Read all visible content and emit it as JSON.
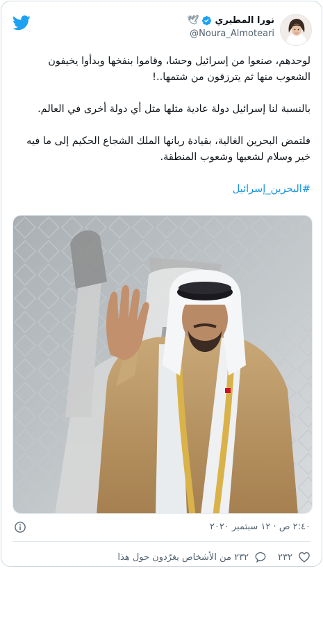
{
  "author": {
    "display_name": "نورا المطيري",
    "dove_emoji": "🕊",
    "handle": "@Noura_Almoteari",
    "verified": true
  },
  "icons": {
    "brand": "twitter-bird-icon",
    "verified": "verified-badge-icon",
    "info": "info-icon",
    "like": "heart-icon",
    "reply": "speech-bubble-icon"
  },
  "colors": {
    "brand_blue": "#1da1f2",
    "link_blue": "#1b95e0",
    "muted": "#536471"
  },
  "tweet": {
    "paragraph_1": "لوحدهم، صنعوا من إسرائيل وحشا، وقاموا بنفخها وبدأوا يخيفون الشعوب منها ثم يترزقون من شتمها..!",
    "paragraph_2": "بالنسبة لنا إسرائيل دولة عادية مثلها مثل أي دولة أخرى في العالم.",
    "paragraph_3": "فلتمض البحرين الغالية، بقيادة ربانها الملك الشجاع الحكيم إلى ما فيه خير وسلام لشعبها وشعوب المنطقة.",
    "hashtag": "#البحرين_إسرائيل"
  },
  "meta": {
    "timestamp": "٢:٤٠ ص · ١٢ سبتمبر ٢٠٢٠"
  },
  "actions": {
    "like_count": "٢٣٢",
    "reply_text": "٢٣٢ من الأشخاص يغرّدون حول هذا"
  }
}
